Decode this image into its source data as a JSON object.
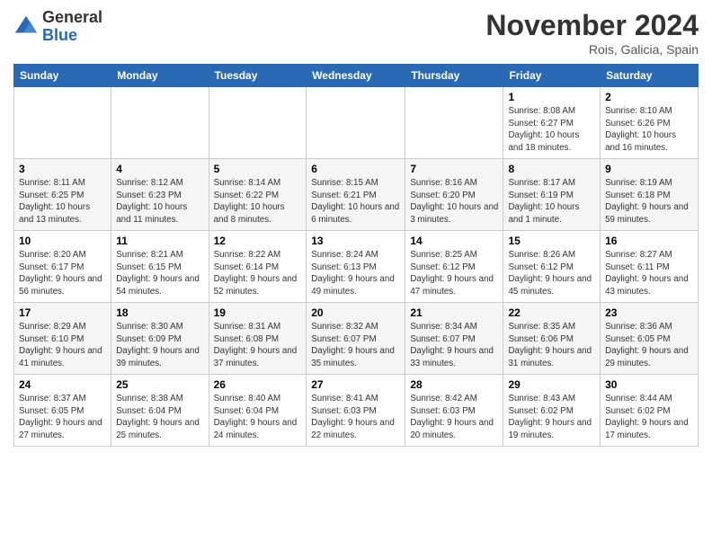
{
  "header": {
    "logo_general": "General",
    "logo_blue": "Blue",
    "month_title": "November 2024",
    "location": "Rois, Galicia, Spain"
  },
  "days_of_week": [
    "Sunday",
    "Monday",
    "Tuesday",
    "Wednesday",
    "Thursday",
    "Friday",
    "Saturday"
  ],
  "weeks": [
    [
      {
        "day": "",
        "info": ""
      },
      {
        "day": "",
        "info": ""
      },
      {
        "day": "",
        "info": ""
      },
      {
        "day": "",
        "info": ""
      },
      {
        "day": "",
        "info": ""
      },
      {
        "day": "1",
        "info": "Sunrise: 8:08 AM\nSunset: 6:27 PM\nDaylight: 10 hours and 18 minutes."
      },
      {
        "day": "2",
        "info": "Sunrise: 8:10 AM\nSunset: 6:26 PM\nDaylight: 10 hours and 16 minutes."
      }
    ],
    [
      {
        "day": "3",
        "info": "Sunrise: 8:11 AM\nSunset: 6:25 PM\nDaylight: 10 hours and 13 minutes."
      },
      {
        "day": "4",
        "info": "Sunrise: 8:12 AM\nSunset: 6:23 PM\nDaylight: 10 hours and 11 minutes."
      },
      {
        "day": "5",
        "info": "Sunrise: 8:14 AM\nSunset: 6:22 PM\nDaylight: 10 hours and 8 minutes."
      },
      {
        "day": "6",
        "info": "Sunrise: 8:15 AM\nSunset: 6:21 PM\nDaylight: 10 hours and 6 minutes."
      },
      {
        "day": "7",
        "info": "Sunrise: 8:16 AM\nSunset: 6:20 PM\nDaylight: 10 hours and 3 minutes."
      },
      {
        "day": "8",
        "info": "Sunrise: 8:17 AM\nSunset: 6:19 PM\nDaylight: 10 hours and 1 minute."
      },
      {
        "day": "9",
        "info": "Sunrise: 8:19 AM\nSunset: 6:18 PM\nDaylight: 9 hours and 59 minutes."
      }
    ],
    [
      {
        "day": "10",
        "info": "Sunrise: 8:20 AM\nSunset: 6:17 PM\nDaylight: 9 hours and 56 minutes."
      },
      {
        "day": "11",
        "info": "Sunrise: 8:21 AM\nSunset: 6:15 PM\nDaylight: 9 hours and 54 minutes."
      },
      {
        "day": "12",
        "info": "Sunrise: 8:22 AM\nSunset: 6:14 PM\nDaylight: 9 hours and 52 minutes."
      },
      {
        "day": "13",
        "info": "Sunrise: 8:24 AM\nSunset: 6:13 PM\nDaylight: 9 hours and 49 minutes."
      },
      {
        "day": "14",
        "info": "Sunrise: 8:25 AM\nSunset: 6:12 PM\nDaylight: 9 hours and 47 minutes."
      },
      {
        "day": "15",
        "info": "Sunrise: 8:26 AM\nSunset: 6:12 PM\nDaylight: 9 hours and 45 minutes."
      },
      {
        "day": "16",
        "info": "Sunrise: 8:27 AM\nSunset: 6:11 PM\nDaylight: 9 hours and 43 minutes."
      }
    ],
    [
      {
        "day": "17",
        "info": "Sunrise: 8:29 AM\nSunset: 6:10 PM\nDaylight: 9 hours and 41 minutes."
      },
      {
        "day": "18",
        "info": "Sunrise: 8:30 AM\nSunset: 6:09 PM\nDaylight: 9 hours and 39 minutes."
      },
      {
        "day": "19",
        "info": "Sunrise: 8:31 AM\nSunset: 6:08 PM\nDaylight: 9 hours and 37 minutes."
      },
      {
        "day": "20",
        "info": "Sunrise: 8:32 AM\nSunset: 6:07 PM\nDaylight: 9 hours and 35 minutes."
      },
      {
        "day": "21",
        "info": "Sunrise: 8:34 AM\nSunset: 6:07 PM\nDaylight: 9 hours and 33 minutes."
      },
      {
        "day": "22",
        "info": "Sunrise: 8:35 AM\nSunset: 6:06 PM\nDaylight: 9 hours and 31 minutes."
      },
      {
        "day": "23",
        "info": "Sunrise: 8:36 AM\nSunset: 6:05 PM\nDaylight: 9 hours and 29 minutes."
      }
    ],
    [
      {
        "day": "24",
        "info": "Sunrise: 8:37 AM\nSunset: 6:05 PM\nDaylight: 9 hours and 27 minutes."
      },
      {
        "day": "25",
        "info": "Sunrise: 8:38 AM\nSunset: 6:04 PM\nDaylight: 9 hours and 25 minutes."
      },
      {
        "day": "26",
        "info": "Sunrise: 8:40 AM\nSunset: 6:04 PM\nDaylight: 9 hours and 24 minutes."
      },
      {
        "day": "27",
        "info": "Sunrise: 8:41 AM\nSunset: 6:03 PM\nDaylight: 9 hours and 22 minutes."
      },
      {
        "day": "28",
        "info": "Sunrise: 8:42 AM\nSunset: 6:03 PM\nDaylight: 9 hours and 20 minutes."
      },
      {
        "day": "29",
        "info": "Sunrise: 8:43 AM\nSunset: 6:02 PM\nDaylight: 9 hours and 19 minutes."
      },
      {
        "day": "30",
        "info": "Sunrise: 8:44 AM\nSunset: 6:02 PM\nDaylight: 9 hours and 17 minutes."
      }
    ]
  ]
}
